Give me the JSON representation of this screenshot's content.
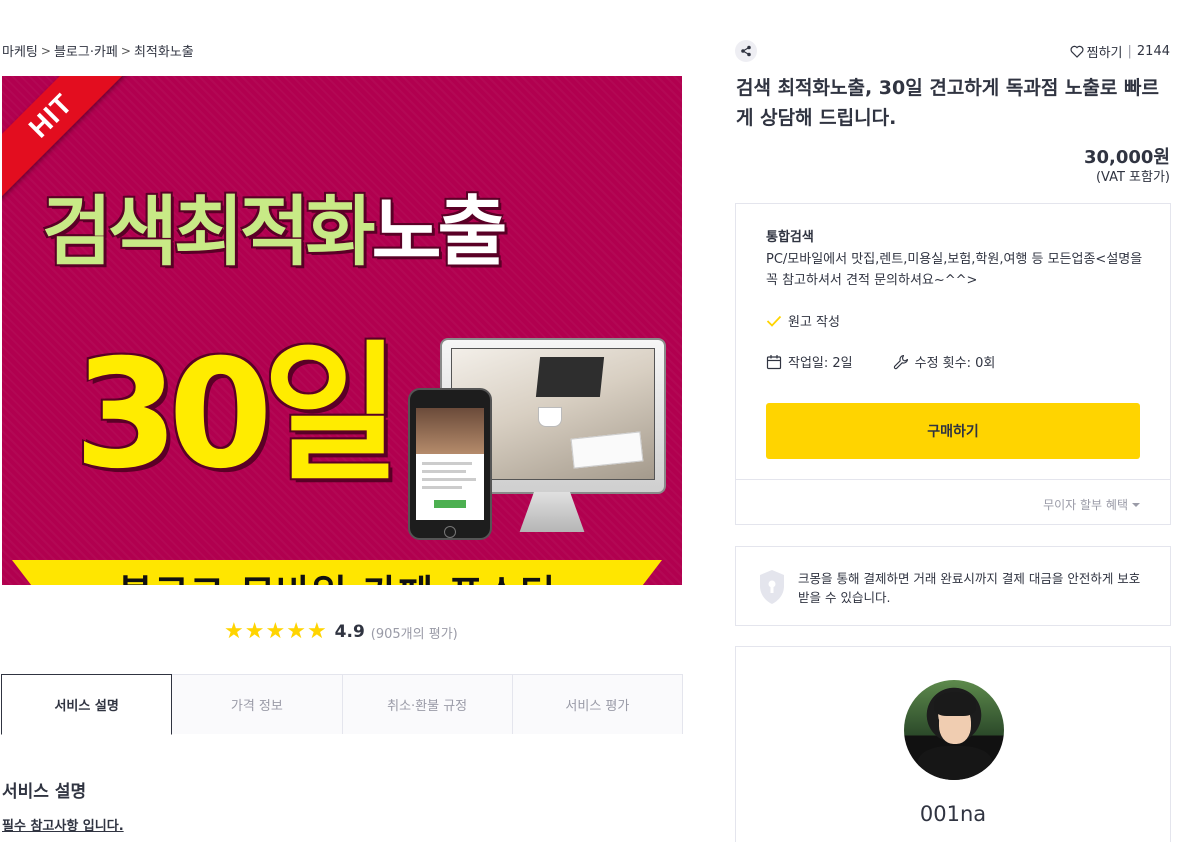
{
  "breadcrumb": [
    "마케팅",
    "블로그·카페",
    "최적화노출"
  ],
  "banner": {
    "ribbon": "HIT",
    "title_part1": "검색최적화",
    "title_part2": "노출",
    "days": "30일",
    "strip": "블로그 모바일 카페 포스터"
  },
  "rating": {
    "score": "4.9",
    "count": "(905개의 평가)",
    "stars": 5
  },
  "tabs": [
    {
      "label": "서비스 설명",
      "active": true
    },
    {
      "label": "가격 정보"
    },
    {
      "label": "취소·환불 규정"
    },
    {
      "label": "서비스 평가"
    }
  ],
  "content": {
    "section_title": "서비스 설명",
    "note": "필수 참고사항 입니다."
  },
  "header": {
    "wish_label": "찜하기",
    "wish_count": "2144"
  },
  "product": {
    "title": "검색 최적화노출, 30일 견고하게 독과점 노출로 빠르게 상담해 드립니다.",
    "price": "30,000원",
    "vat": "(VAT 포함가)"
  },
  "package": {
    "name": "통합검색",
    "description": "PC/모바일에서 맛집,렌트,미용실,보험,학원,여행 등 모든업종<설명을 꼭 참고하셔서 견적 문의하셔요~^^>",
    "feature": "원고 작성",
    "work_days": "작업일: 2일",
    "revisions": "수정 횟수: 0회",
    "buy_label": "구매하기",
    "installment": "무이자 할부 혜택"
  },
  "secure": {
    "text": "크몽을 통해 결제하면 거래 완료시까지 결제 대금을 안전하게 보호 받을 수 있습니다."
  },
  "seller": {
    "name": "001na"
  },
  "colors": {
    "accent": "#ffd400",
    "banner_bg": "#b1004f",
    "text": "#303441",
    "muted": "#9a9ba7"
  }
}
